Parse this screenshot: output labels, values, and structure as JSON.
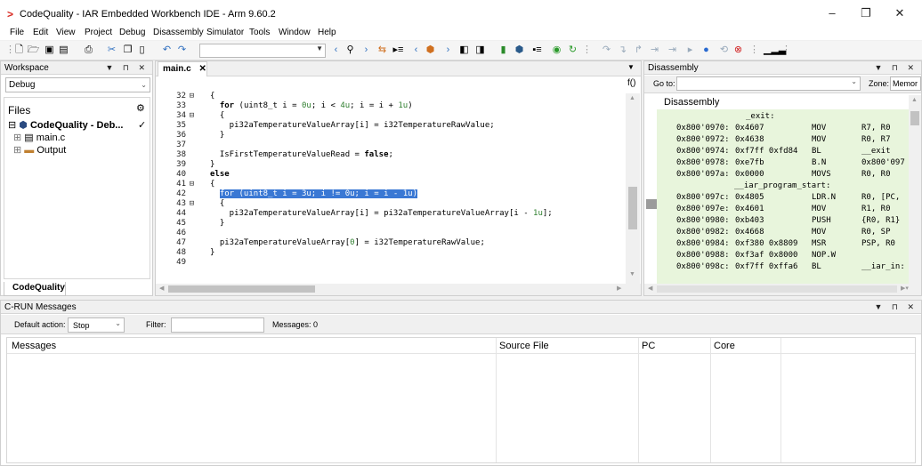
{
  "window": {
    "title": "CodeQuality - IAR Embedded Workbench IDE - Arm 9.60.2",
    "minimize": "–",
    "maximize": "❐",
    "close": "✕"
  },
  "menu": [
    "File",
    "Edit",
    "View",
    "Project",
    "Debug",
    "Disassembly",
    "Simulator",
    "Tools",
    "Window",
    "Help"
  ],
  "workspace": {
    "header": "Workspace",
    "config": "Debug",
    "files_label": "Files",
    "project": "CodeQuality - Deb...",
    "project_check": "✓",
    "items": [
      "main.c",
      "Output"
    ],
    "tab": "CodeQuality"
  },
  "editor": {
    "tab": "main.c",
    "fx": "f()",
    "lines": [
      {
        "n": "32",
        "fold": "⊟",
        "text": "{"
      },
      {
        "n": "33",
        "fold": "",
        "text": "  for (uint8_t i = 0u; i < 4u; i = i + 1u)"
      },
      {
        "n": "34",
        "fold": "⊟",
        "text": "  {"
      },
      {
        "n": "35",
        "fold": "",
        "text": "    pi32aTemperatureValueArray[i] = i32TemperatureRawValue;"
      },
      {
        "n": "36",
        "fold": "",
        "text": "  }"
      },
      {
        "n": "37",
        "fold": "",
        "text": ""
      },
      {
        "n": "38",
        "fold": "",
        "text": "  IsFirstTemperatureValueRead = false;"
      },
      {
        "n": "39",
        "fold": "",
        "text": "}"
      },
      {
        "n": "40",
        "fold": "",
        "text": "else"
      },
      {
        "n": "41",
        "fold": "⊟",
        "text": "{"
      },
      {
        "n": "42",
        "fold": "",
        "text": "  for (uint8_t i = 3u; i != 0u; i = i - 1u)"
      },
      {
        "n": "43",
        "fold": "⊟",
        "text": "  {"
      },
      {
        "n": "44",
        "fold": "",
        "text": "    pi32aTemperatureValueArray[i] = pi32aTemperatureValueArray[i - 1u];"
      },
      {
        "n": "45",
        "fold": "",
        "text": "  }"
      },
      {
        "n": "46",
        "fold": "",
        "text": ""
      },
      {
        "n": "47",
        "fold": "",
        "text": "  pi32aTemperatureValueArray[0] = i32TemperatureRawValue;"
      },
      {
        "n": "48",
        "fold": "",
        "text": "}"
      },
      {
        "n": "49",
        "fold": "",
        "text": ""
      }
    ]
  },
  "disassembly": {
    "header": "Disassembly",
    "goto_label": "Go to:",
    "zone_label": "Zone:",
    "zone_value": "Memor",
    "title": "Disassembly",
    "lines": [
      {
        "addr": "",
        "bytes": "_exit:",
        "op": "",
        "args": ""
      },
      {
        "addr": "0x800'0970:",
        "bytes": "0x4607",
        "op": "MOV",
        "args": "R7, R0"
      },
      {
        "addr": "0x800'0972:",
        "bytes": "0x4638",
        "op": "MOV",
        "args": "R0, R7"
      },
      {
        "addr": "0x800'0974:",
        "bytes": "0xf7ff 0xfd84",
        "op": "BL",
        "args": "__exit"
      },
      {
        "addr": "0x800'0978:",
        "bytes": "0xe7fb",
        "op": "B.N",
        "args": "0x800'097"
      },
      {
        "addr": "0x800'097a:",
        "bytes": "0x0000",
        "op": "MOVS",
        "args": "R0, R0"
      },
      {
        "addr": "",
        "bytes": "__iar_program_start:",
        "op": "",
        "args": ""
      },
      {
        "addr": "0x800'097c:",
        "bytes": "0x4805",
        "op": "LDR.N",
        "args": "R0, [PC,"
      },
      {
        "addr": "0x800'097e:",
        "bytes": "0x4601",
        "op": "MOV",
        "args": "R1, R0"
      },
      {
        "addr": "0x800'0980:",
        "bytes": "0xb403",
        "op": "PUSH",
        "args": "{R0, R1}"
      },
      {
        "addr": "0x800'0982:",
        "bytes": "0x4668",
        "op": "MOV",
        "args": "R0, SP"
      },
      {
        "addr": "0x800'0984:",
        "bytes": "0xf380 0x8809",
        "op": "MSR",
        "args": "PSP, R0"
      },
      {
        "addr": "0x800'0988:",
        "bytes": "0xf3af 0x8000",
        "op": "NOP.W",
        "args": ""
      },
      {
        "addr": "0x800'098c:",
        "bytes": "0xf7ff 0xffa6",
        "op": "BL",
        "args": "__iar_in:"
      }
    ]
  },
  "crun": {
    "header": "C-RUN Messages",
    "default_action_label": "Default action:",
    "default_action_value": "Stop",
    "filter_label": "Filter:",
    "filter_value": "",
    "messages_count": "Messages: 0",
    "columns": [
      "Messages",
      "Source File",
      "PC",
      "Core"
    ]
  },
  "colors": {
    "selection": "#3a78d4",
    "disasm_bg": "#e8f5dc",
    "number": "#2f7f2f"
  }
}
